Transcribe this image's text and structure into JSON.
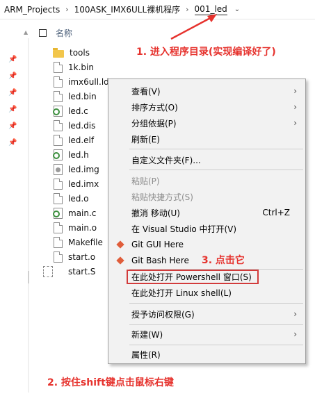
{
  "breadcrumb": {
    "items": [
      "ARM_Projects",
      "100ASK_IMX6ULL裸机程序",
      "001_led"
    ],
    "separator": "›",
    "dropdown": "⌄"
  },
  "list_header": {
    "name_col": "名称"
  },
  "files": [
    {
      "name": "tools",
      "icon": "folder"
    },
    {
      "name": "1k.bin",
      "icon": "doc"
    },
    {
      "name": "imx6ull.ld",
      "icon": "doc"
    },
    {
      "name": "led.bin",
      "icon": "doc"
    },
    {
      "name": "led.c",
      "icon": "c-source"
    },
    {
      "name": "led.dis",
      "icon": "doc"
    },
    {
      "name": "led.elf",
      "icon": "doc"
    },
    {
      "name": "led.h",
      "icon": "c-source"
    },
    {
      "name": "led.img",
      "icon": "disk-image"
    },
    {
      "name": "led.imx",
      "icon": "doc"
    },
    {
      "name": "led.o",
      "icon": "doc"
    },
    {
      "name": "main.c",
      "icon": "c-source"
    },
    {
      "name": "main.o",
      "icon": "doc"
    },
    {
      "name": "Makefile",
      "icon": "doc"
    },
    {
      "name": "start.o",
      "icon": "doc"
    },
    {
      "name": "start.S",
      "icon": "asm"
    }
  ],
  "menu": {
    "view": "查看(V)",
    "sort": "排序方式(O)",
    "group": "分组依据(P)",
    "refresh": "刷新(E)",
    "customize": "自定义文件夹(F)...",
    "paste": "粘贴(P)",
    "paste_shortcut": "粘贴快捷方式(S)",
    "undo": "撤消 移动(U)",
    "undo_shortcut": "Ctrl+Z",
    "open_vs": "在 Visual Studio 中打开(V)",
    "git_gui": "Git GUI Here",
    "git_bash": "Git Bash Here",
    "powershell": "在此处打开 Powershell 窗口(S)",
    "linux_shell": "在此处打开 Linux shell(L)",
    "give_access": "授予访问权限(G)",
    "new": "新建(W)",
    "properties": "属性(R)",
    "submenu_arrow": "›"
  },
  "annotations": {
    "step1": "1. 进入程序目录(实现编译好了)",
    "step2": "2. 按住shift键点击鼠标右键",
    "step3": "3. 点击它",
    "color": "#e6322d"
  },
  "colors": {
    "menu_bg": "#f2f2f2",
    "header_text": "#4c607a",
    "git_icon": "#e05d3a"
  }
}
